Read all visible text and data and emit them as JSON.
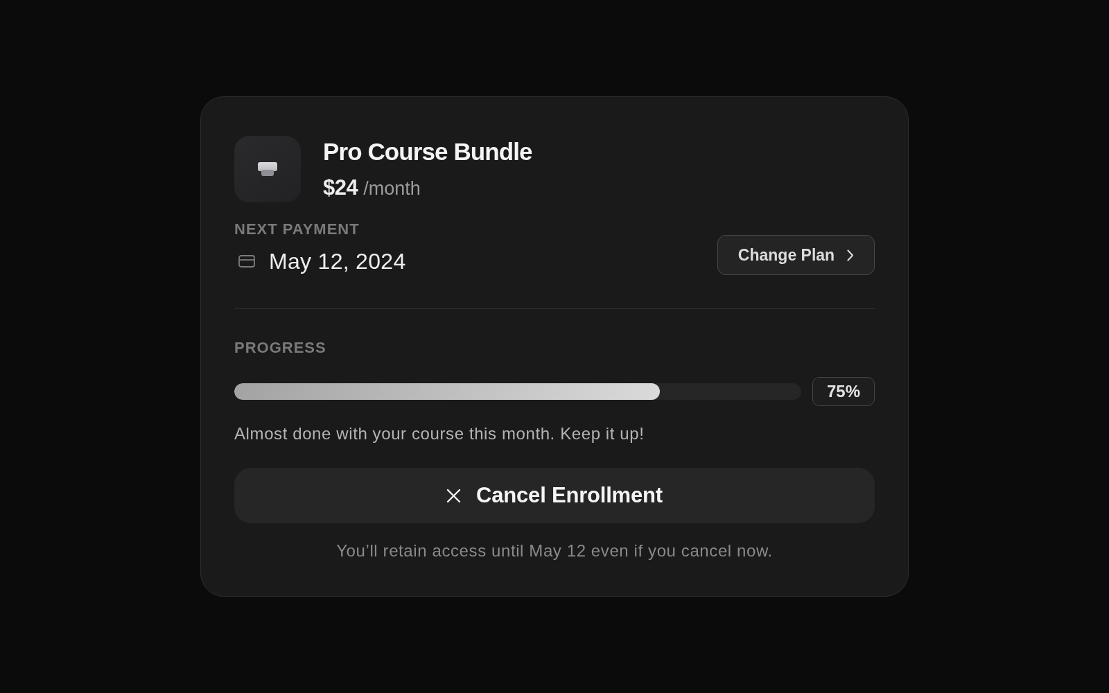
{
  "product": {
    "title": "Pro Course Bundle",
    "price": "$24",
    "period": "/month"
  },
  "next_payment": {
    "label": "NEXT PAYMENT",
    "date": "May 12, 2024"
  },
  "change_plan_button": {
    "label": "Change Plan"
  },
  "progress": {
    "label": "PROGRESS",
    "level": 0.75,
    "reading": "75%",
    "message": "Almost done with your course this month. Keep it up!"
  },
  "cancel_button": {
    "label": "Cancel Enrollment"
  },
  "footer_note": "You’ll retain access until May 12 even if you cancel now."
}
